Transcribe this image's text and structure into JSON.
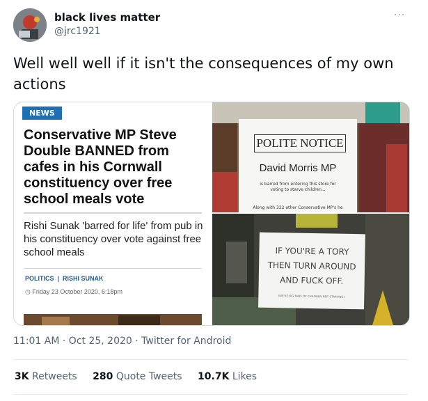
{
  "user": {
    "name": "black lives matter",
    "handle": "@jrc1921",
    "avatar_icon": "avatar-photo-icon"
  },
  "more_icon": "···",
  "tweet_text": "Well well well if it isn't the consequences of my own actions",
  "media": {
    "article": {
      "badge": "NEWS",
      "headline": "Conservative MP Steve Double BANNED from cafes in his Cornwall constituency over free school meals vote",
      "subheadline": "Rishi Sunak 'barred for life' from pub in his constituency over vote against free school meals",
      "tag1": "POLITICS",
      "tag2": "RISHI SUNAK",
      "date": "Friday 23 October 2020, 6:18pm"
    },
    "notice1": {
      "title": "POLITE NOTICE",
      "name": "David Morris MP",
      "body": "is barred from entering this store for voting to starve children...",
      "footer": "Along with 322 other Conservative MP's he"
    },
    "notice2": {
      "line1": "IF YOU'RE A TORY",
      "line2": "THEN TURN AROUND",
      "line3": "AND FUCK OFF.",
      "small": "(WE'RE BIG FANS OF CHILDREN NOT STARVING)"
    }
  },
  "meta": "11:01 AM · Oct 25, 2020 · Twitter for Android",
  "stats": {
    "retweets_count": "3K",
    "retweets_label": "Retweets",
    "quotes_count": "280",
    "quotes_label": "Quote Tweets",
    "likes_count": "10.7K",
    "likes_label": "Likes"
  }
}
